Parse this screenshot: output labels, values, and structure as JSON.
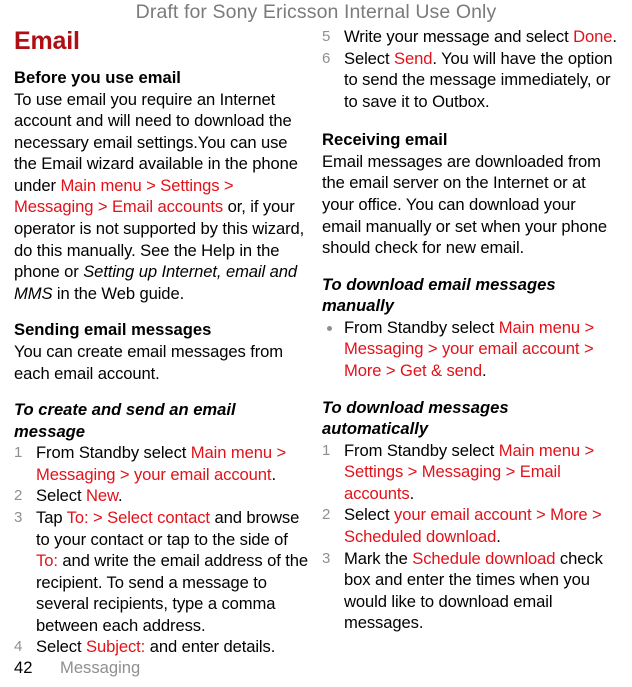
{
  "header": {
    "draft_notice": "Draft for Sony Ericsson Internal Use Only"
  },
  "colors": {
    "chapter_title": "#af0f14",
    "ui_reference": "#e1121a",
    "muted": "#8f8f8f",
    "draft_notice": "#7b7b7b",
    "body": "#000000"
  },
  "chapter": {
    "title": "Email"
  },
  "left_column": {
    "section1": {
      "heading": "Before you use email",
      "para_part1": "To use email you require an Internet account and will need to download the necessary email settings.You can use the Email wizard available in the phone under ",
      "ui_ref1": "Main menu > Settings > Messaging > Email accounts",
      "para_part2": " or, if your operator is not supported by this wizard, do this manually. See the Help in the phone or ",
      "italic_title": "Setting up Internet, email and MMS",
      "para_part3": " in the Web guide."
    },
    "section2": {
      "heading": "Sending email messages",
      "para": "You can create email messages from each email account."
    },
    "procedure": {
      "heading": "To create and send an email message",
      "steps": [
        {
          "number": "1",
          "parts": [
            {
              "text": "From Standby select ",
              "style": "plain"
            },
            {
              "text": "Main menu > Messaging > your email account",
              "style": "ui"
            },
            {
              "text": ".",
              "style": "plain"
            }
          ]
        },
        {
          "number": "2",
          "parts": [
            {
              "text": "Select ",
              "style": "plain"
            },
            {
              "text": "New",
              "style": "ui"
            },
            {
              "text": ".",
              "style": "plain"
            }
          ]
        },
        {
          "number": "3",
          "parts": [
            {
              "text": "Tap ",
              "style": "plain"
            },
            {
              "text": "To: > Select contact",
              "style": "ui"
            },
            {
              "text": " and browse to your contact or tap to the side of ",
              "style": "plain"
            },
            {
              "text": "To:",
              "style": "ui"
            },
            {
              "text": " and write the email address of the recipient. To send a message to several recipients, type a comma between each address.",
              "style": "plain"
            }
          ]
        },
        {
          "number": "4",
          "parts": [
            {
              "text": "Select ",
              "style": "plain"
            },
            {
              "text": "Subject:",
              "style": "ui"
            },
            {
              "text": " and enter details.",
              "style": "plain"
            }
          ]
        }
      ]
    }
  },
  "right_column": {
    "continued_steps": [
      {
        "number": "5",
        "parts": [
          {
            "text": "Write your message and select ",
            "style": "plain"
          },
          {
            "text": "Done",
            "style": "ui"
          },
          {
            "text": ".",
            "style": "plain"
          }
        ]
      },
      {
        "number": "6",
        "parts": [
          {
            "text": "Select ",
            "style": "plain"
          },
          {
            "text": "Send",
            "style": "ui"
          },
          {
            "text": ". You will have the option to send the message immediately, or to save it to Outbox.",
            "style": "plain"
          }
        ]
      }
    ],
    "section3": {
      "heading": "Receiving email",
      "para": "Email messages are downloaded from the email server on the Internet or at your office. You can download your email manually or set when your phone should check for new email."
    },
    "procedure_manual": {
      "heading": "To download email messages manually",
      "bullets": [
        {
          "parts": [
            {
              "text": "From Standby select ",
              "style": "plain"
            },
            {
              "text": "Main menu > Messaging > your email account > More > Get & send",
              "style": "ui"
            },
            {
              "text": ".",
              "style": "plain"
            }
          ]
        }
      ]
    },
    "procedure_auto": {
      "heading": "To download messages automatically",
      "steps": [
        {
          "number": "1",
          "parts": [
            {
              "text": "From Standby select ",
              "style": "plain"
            },
            {
              "text": "Main menu > Settings > Messaging > Email accounts",
              "style": "ui"
            },
            {
              "text": ".",
              "style": "plain"
            }
          ]
        },
        {
          "number": "2",
          "parts": [
            {
              "text": "Select ",
              "style": "plain"
            },
            {
              "text": "your email account > More > Scheduled download",
              "style": "ui"
            },
            {
              "text": ".",
              "style": "plain"
            }
          ]
        },
        {
          "number": "3",
          "parts": [
            {
              "text": "Mark the ",
              "style": "plain"
            },
            {
              "text": "Schedule download",
              "style": "ui"
            },
            {
              "text": " check box and enter the times when you would like to download email messages.",
              "style": "plain"
            }
          ]
        }
      ]
    }
  },
  "footer": {
    "page_number": "42",
    "section_name": "Messaging"
  }
}
